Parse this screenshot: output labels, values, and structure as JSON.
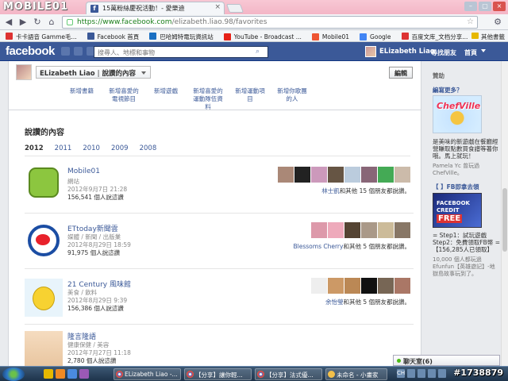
{
  "browser": {
    "watermark_logo": "MOBILE01",
    "tab_title": "15萬粉絲慶祝活動！- 愛樂迪",
    "url_host": "https://www.facebook.com",
    "url_path": "/elizabeth.liao.98/favorites",
    "bookmarks": [
      {
        "label": "卡卡語音 Gamme毛...",
        "color": "#d33"
      },
      {
        "label": "Facebook 首頁",
        "color": "#3b5998"
      },
      {
        "label": "巴哈姆特電玩資訊站",
        "color": "#1a6fc2"
      },
      {
        "label": "YouTube - Broadcast ...",
        "color": "#e62117"
      },
      {
        "label": "Mobile01",
        "color": "#e53"
      },
      {
        "label": "Google",
        "color": "#4285f4"
      },
      {
        "label": "百度文库_文档分享...",
        "color": "#d33"
      },
      {
        "label": "",
        "color": "#aaa"
      }
    ],
    "other_bookmarks": "其他書籤"
  },
  "fb_header": {
    "logo": "facebook",
    "search_placeholder": "搜尋人、地標和事物",
    "user_name": "ELizabeth Liao",
    "find_friends": "尋找朋友",
    "home": "首頁"
  },
  "profile": {
    "name": "ELizabeth Liao",
    "section": "說讚的內容",
    "edit_button": "編輯",
    "add_links": [
      "新增書籍",
      "新增喜愛的電視節目",
      "新增遊戲",
      "新增喜愛的運動隊伍資料",
      "新增運動項目",
      "新增你歌團的人"
    ]
  },
  "likes": {
    "title": "說讚的內容",
    "years": [
      "2012",
      "2011",
      "2010",
      "2009",
      "2008"
    ],
    "items": [
      {
        "title": "Mobile01",
        "category": "網站",
        "date": "2012年9月7日 21:28",
        "likes": "156,541 個人說這讚",
        "friends_name": "林士凱",
        "friends_rest": "和其他 15 個朋友都說讚。"
      },
      {
        "title": "ETtoday新聞雲",
        "category": "媒體 / 新聞 / 出版業",
        "date": "2012年8月29日 18:59",
        "likes": "91,975 個人說這讚",
        "friends_name": "Blessoms Cherry",
        "friends_rest": "和其他 5 個朋友都說讚。"
      },
      {
        "title": "21 Century 風味館",
        "category": "美食 / 飲料",
        "date": "2012年8月29日 9:39",
        "likes": "156,386 個人說這讚",
        "friends_name": "余怡瑩",
        "friends_rest": "和其他 5 個朋友都說讚。"
      },
      {
        "title": "隆言隆語",
        "category": "健康保健 / 美容",
        "date": "2012年7月27日 11:18",
        "likes": "2,780 個人說這讚",
        "friends_name": "",
        "friends_rest": ""
      }
    ]
  },
  "sidebar": {
    "sponsor": "贊助",
    "create_ad": "編寫更多？",
    "ad1_title": "ChefVille",
    "ad1_text": "是美味的新遊戲在餐廳經營賺取點數買食譜等著你哦。馬上就玩！",
    "ad1_source": "Pamela Yc 曾玩過 ChefVille。",
    "ad2_title": "【 】FB即拿去領",
    "ad2_img1": "FACEBOOK CREDIT",
    "ad2_img2": "FREE",
    "ad2_text": "= Step1：試玩遊戲 Step2：免費領取FB幣 = 【156,285人已領取】",
    "ad2_source": "10,000 個人都玩過 Efunfun【英雄遊記】-地獄島故事玩到了。"
  },
  "chat": {
    "label": "聊天室(6)"
  },
  "taskbar": {
    "tasks": [
      "ELizabeth Liao -...",
      "【分享】讓你輕...",
      "【分享】法式優...",
      "未命名 - 小畫家"
    ],
    "tray": [
      "CH"
    ],
    "watermark": "#1738879"
  }
}
